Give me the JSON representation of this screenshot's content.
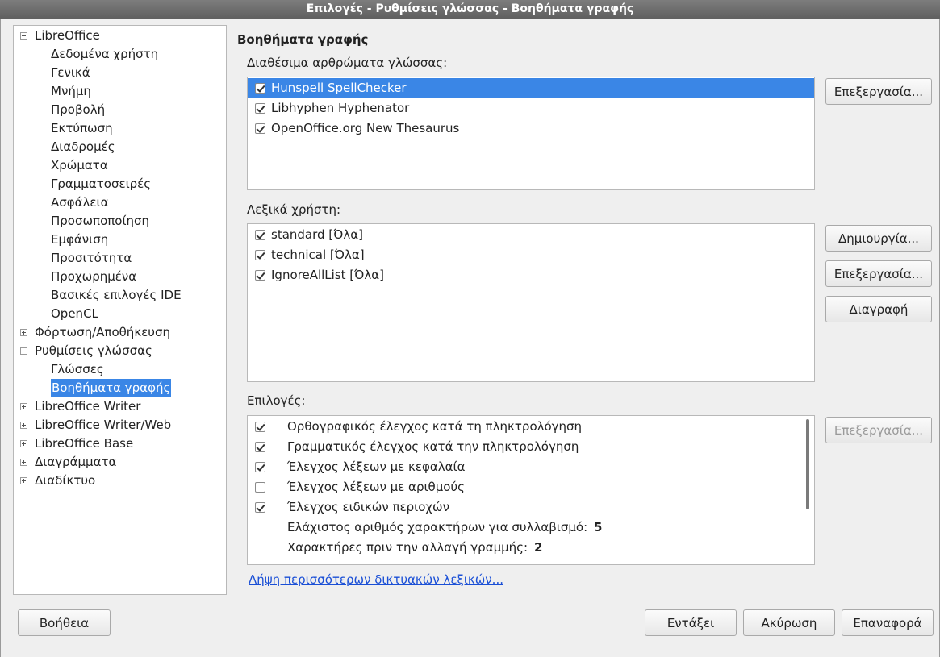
{
  "window": {
    "title": "Επιλογές - Ρυθμίσεις γλώσσας - Βοηθήματα γραφής"
  },
  "tree": [
    {
      "label": "LibreOffice",
      "level": 0,
      "expander": "minus"
    },
    {
      "label": "Δεδομένα χρήστη",
      "level": 1
    },
    {
      "label": "Γενικά",
      "level": 1
    },
    {
      "label": "Μνήμη",
      "level": 1
    },
    {
      "label": "Προβολή",
      "level": 1
    },
    {
      "label": "Εκτύπωση",
      "level": 1
    },
    {
      "label": "Διαδρομές",
      "level": 1
    },
    {
      "label": "Χρώματα",
      "level": 1
    },
    {
      "label": "Γραμματοσειρές",
      "level": 1
    },
    {
      "label": "Ασφάλεια",
      "level": 1
    },
    {
      "label": "Προσωποποίηση",
      "level": 1
    },
    {
      "label": "Εμφάνιση",
      "level": 1
    },
    {
      "label": "Προσιτότητα",
      "level": 1
    },
    {
      "label": "Προχωρημένα",
      "level": 1
    },
    {
      "label": "Βασικές επιλογές IDE",
      "level": 1
    },
    {
      "label": "OpenCL",
      "level": 1
    },
    {
      "label": "Φόρτωση/Αποθήκευση",
      "level": 0,
      "expander": "plus"
    },
    {
      "label": "Ρυθμίσεις γλώσσας",
      "level": 0,
      "expander": "minus"
    },
    {
      "label": "Γλώσσες",
      "level": 1
    },
    {
      "label": "Βοηθήματα γραφής",
      "level": 1,
      "selected": true
    },
    {
      "label": "LibreOffice Writer",
      "level": 0,
      "expander": "plus"
    },
    {
      "label": "LibreOffice Writer/Web",
      "level": 0,
      "expander": "plus"
    },
    {
      "label": "LibreOffice Base",
      "level": 0,
      "expander": "plus"
    },
    {
      "label": "Διαγράμματα",
      "level": 0,
      "expander": "plus"
    },
    {
      "label": "Διαδίκτυο",
      "level": 0,
      "expander": "plus"
    }
  ],
  "page": {
    "heading": "Βοηθήματα γραφής",
    "modules_label": "Διαθέσιμα αρθρώματα γλώσσας:",
    "modules": [
      {
        "label": "Hunspell SpellChecker",
        "checked": true,
        "selected": true
      },
      {
        "label": "Libhyphen Hyphenator",
        "checked": true
      },
      {
        "label": "OpenOffice.org New Thesaurus",
        "checked": true
      }
    ],
    "modules_edit_button": "Επεξεργασία...",
    "dicts_label": "Λεξικά χρήστη:",
    "dicts": [
      {
        "label": "standard [Όλα]",
        "checked": true
      },
      {
        "label": "technical [Όλα]",
        "checked": true
      },
      {
        "label": "IgnoreAllList [Όλα]",
        "checked": true
      }
    ],
    "dict_new_button": "Δημιουργία...",
    "dict_edit_button": "Επεξεργασία...",
    "dict_delete_button": "Διαγραφή",
    "options_label": "Επιλογές:",
    "options": [
      {
        "label": "Ορθογραφικός έλεγχος κατά τη πληκτρολόγηση",
        "checked": true,
        "has_checkbox": true
      },
      {
        "label": "Γραμματικός έλεγχος κατά την πληκτρολόγηση",
        "checked": true,
        "has_checkbox": true
      },
      {
        "label": "Έλεγχος λέξεων με κεφαλαία",
        "checked": true,
        "has_checkbox": true
      },
      {
        "label": "Έλεγχος λέξεων με αριθμούς",
        "checked": false,
        "has_checkbox": true
      },
      {
        "label": "Έλεγχος ειδικών περιοχών",
        "checked": true,
        "has_checkbox": true
      },
      {
        "label": "Ελάχιστος αριθμός χαρακτήρων για συλλαβισμό:",
        "value": "5",
        "has_checkbox": false
      },
      {
        "label": "Χαρακτήρες πριν την αλλαγή γραμμής:",
        "value": "2",
        "has_checkbox": false
      }
    ],
    "options_edit_button": "Επεξεργασία...",
    "more_dicts_link": "Λήψη περισσότερων δικτυακών λεξικών..."
  },
  "footer": {
    "help_button": "Βοήθεια",
    "ok_button": "Εντάξει",
    "cancel_button": "Ακύρωση",
    "reset_button": "Επαναφορά"
  }
}
